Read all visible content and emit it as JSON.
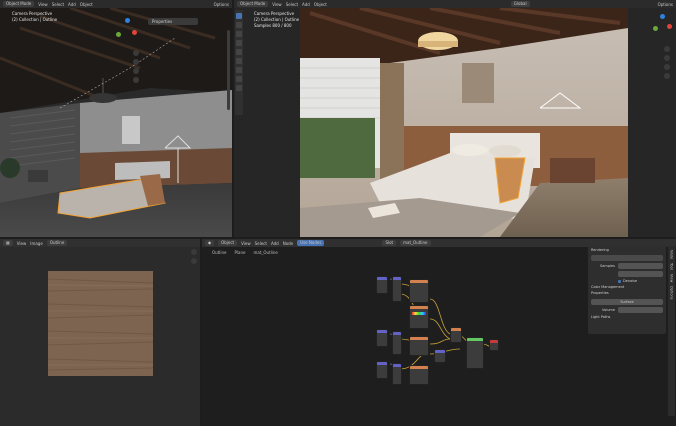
{
  "colors": {
    "accent": "#4772b3",
    "bg": "#1d1d1d",
    "header": "#2b2b2b",
    "node_shader": "#63c763",
    "node_texture": "#d3824f",
    "node_vector": "#6363c7",
    "wire": "#c7a33a",
    "selection": "#f4a233"
  },
  "left_viewport": {
    "header": {
      "mode": "Object Mode",
      "menus": [
        "View",
        "Select",
        "Add",
        "Object"
      ],
      "options": "Options"
    },
    "overlay": {
      "line1": "Camera Perspective",
      "line2": "(2) Collection | Outline"
    },
    "properties_dropdown": "Properties"
  },
  "right_viewport": {
    "header": {
      "mode": "Object Mode",
      "menus": [
        "View",
        "Select",
        "Add",
        "Object"
      ],
      "global": "Global",
      "options": "Options"
    },
    "overlay": {
      "line1": "Camera Perspective",
      "line2": "(2) Collection | Outline",
      "line3": "Samples 800 / 800"
    }
  },
  "image_editor": {
    "header": {
      "view": "View",
      "image": "Image",
      "name": "Outline"
    }
  },
  "node_editor": {
    "header": {
      "object": "Object",
      "menus": [
        "View",
        "Select",
        "Add",
        "Node"
      ],
      "use_nodes": "Use Nodes",
      "slot": "Slot",
      "material": "mat_Outline"
    },
    "breadcrumb": [
      "Outline",
      "Plane",
      "mat_Outline"
    ],
    "side_panel": {
      "section1": "Rendering",
      "field1": "Samples",
      "toggle": "Denoise",
      "section2": "Color Management",
      "section3": "Properties",
      "field2": "Surface",
      "field3": "Volume",
      "section4": "Light Paths"
    },
    "tabs": [
      "Node",
      "Tool",
      "View",
      "Options"
    ]
  }
}
